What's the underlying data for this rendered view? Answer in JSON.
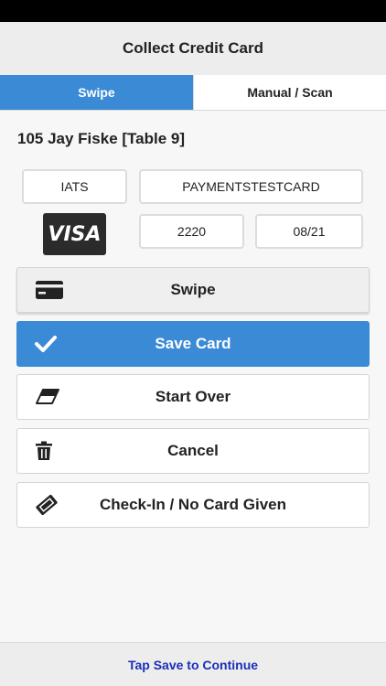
{
  "nav": {
    "title": "Collect Credit Card"
  },
  "tabs": [
    {
      "label": "Swipe",
      "active": true
    },
    {
      "label": "Manual / Scan",
      "active": false
    }
  ],
  "guest": {
    "name": "105 Jay Fiske [Table 9]"
  },
  "card": {
    "processor": "IATS",
    "holder": "PAYMENTSTESTCARD",
    "brand": "VISA",
    "last4": "2220",
    "expiry": "08/21"
  },
  "buttons": {
    "swipe": "Swipe",
    "save": "Save Card",
    "start_over": "Start Over",
    "cancel": "Cancel",
    "checkin": "Check-In / No Card Given"
  },
  "footer": {
    "message": "Tap Save to Continue"
  },
  "colors": {
    "accent": "#3a8ad6",
    "footer_link": "#1a2fb8"
  },
  "icons": {
    "swipe": "credit-card-icon",
    "save": "checkmark-icon",
    "start_over": "eraser-icon",
    "cancel": "trash-icon",
    "checkin": "ticket-icon"
  }
}
